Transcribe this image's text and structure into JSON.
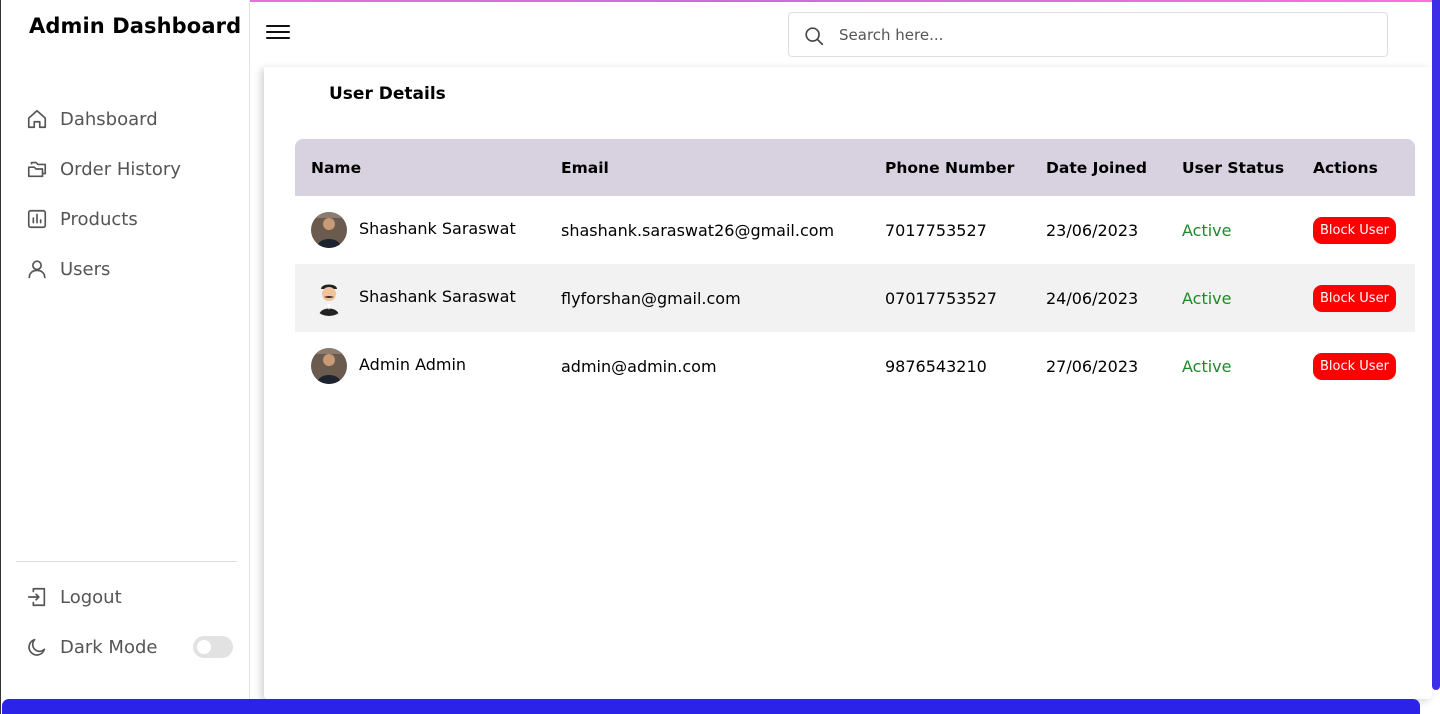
{
  "app": {
    "title": "Admin Dashboard"
  },
  "sidebar": {
    "items": [
      {
        "label": "Dahsboard",
        "icon": "home-icon"
      },
      {
        "label": "Order History",
        "icon": "folders-icon"
      },
      {
        "label": "Products",
        "icon": "bar-chart-icon"
      },
      {
        "label": "Users",
        "icon": "user-icon"
      }
    ],
    "logout_label": "Logout",
    "dark_mode_label": "Dark Mode",
    "dark_mode_on": false
  },
  "search": {
    "placeholder": "Search here...",
    "value": ""
  },
  "main": {
    "title": "User Details",
    "columns": [
      "Name",
      "Email",
      "Phone Number",
      "Date Joined",
      "User Status",
      "Actions"
    ],
    "rows": [
      {
        "name": "Shashank Saraswat",
        "email": "shashank.saraswat26@gmail.com",
        "phone": "7017753527",
        "date": "23/06/2023",
        "status": "Active",
        "action": "Block User",
        "avatar": "photo"
      },
      {
        "name": "Shashank Saraswat",
        "email": "flyforshan@gmail.com",
        "phone": "07017753527",
        "date": "24/06/2023",
        "status": "Active",
        "action": "Block User",
        "avatar": "cartoon"
      },
      {
        "name": "Admin Admin",
        "email": "admin@admin.com",
        "phone": "9876543210",
        "date": "27/06/2023",
        "status": "Active",
        "action": "Block User",
        "avatar": "photo"
      }
    ]
  },
  "colors": {
    "accent": "#2b24e8",
    "table_header": "#d8d2e0",
    "status_active": "#1e8a25",
    "block_button": "#ff0000"
  }
}
